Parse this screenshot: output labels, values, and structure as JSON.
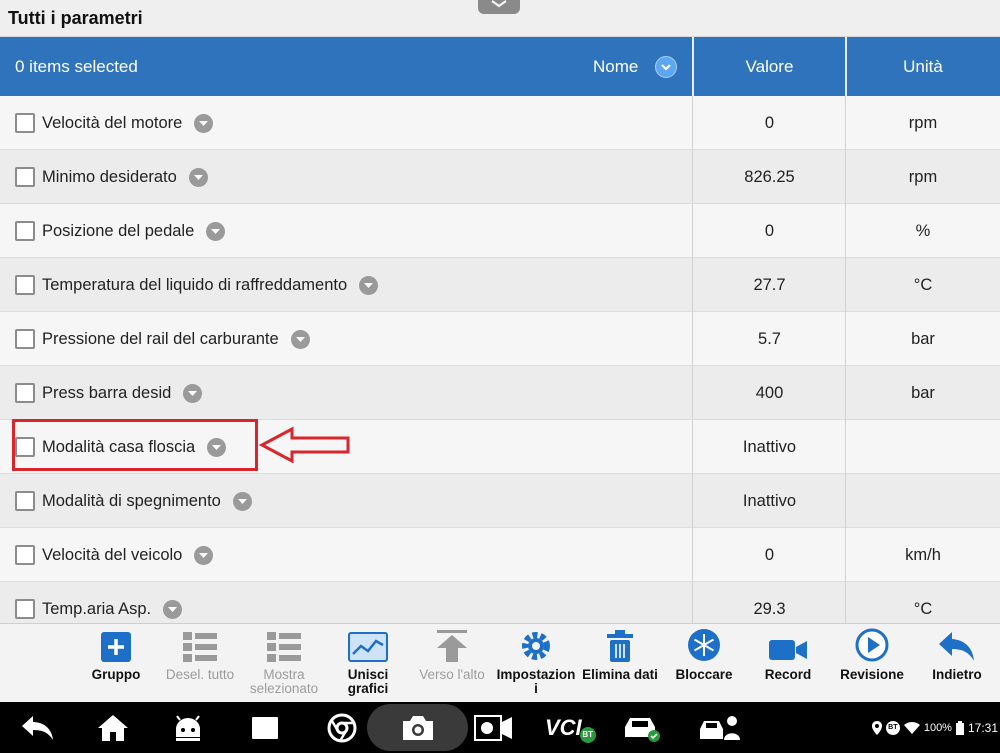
{
  "window": {
    "title": "Tutti i parametri"
  },
  "header": {
    "selection": "0 items selected",
    "name_col": "Nome",
    "value_col": "Valore",
    "unit_col": "Unità"
  },
  "rows": [
    {
      "name": "Velocità del motore",
      "value": "0",
      "unit": "rpm"
    },
    {
      "name": "Minimo desiderato",
      "value": "826.25",
      "unit": "rpm"
    },
    {
      "name": "Posizione del pedale",
      "value": "0",
      "unit": "%"
    },
    {
      "name": "Temperatura del liquido di raffreddamento",
      "value": "27.7",
      "unit": "°C"
    },
    {
      "name": "Pressione del rail del carburante",
      "value": "5.7",
      "unit": "bar"
    },
    {
      "name": "Press barra desid",
      "value": "400",
      "unit": "bar"
    },
    {
      "name": "Modalità casa floscia",
      "value": "Inattivo",
      "unit": ""
    },
    {
      "name": "Modalità di spegnimento",
      "value": "Inattivo",
      "unit": ""
    },
    {
      "name": "Velocità del veicolo",
      "value": "0",
      "unit": "km/h"
    },
    {
      "name": "Temp.aria Asp.",
      "value": "29.3",
      "unit": "°C"
    }
  ],
  "toolbar": {
    "group": "Gruppo",
    "deselect_all": "Desel. tutto",
    "show_selected_1": "Mostra",
    "show_selected_2": "selezionato",
    "merge_graphs_1": "Unisci",
    "merge_graphs_2": "grafici",
    "move_up": "Verso l'alto",
    "settings_1": "Impostazion",
    "settings_2": "i",
    "clear_data": "Elimina dati",
    "freeze": "Bloccare",
    "record": "Record",
    "review": "Revisione",
    "back": "Indietro"
  },
  "status_bar": {
    "vci": "VCI",
    "vci_badge": "BT",
    "bt": "BT",
    "battery": "100%",
    "time": "17:31"
  },
  "colors": {
    "header_blue": "#2f73bd",
    "highlight_red": "#d8262c",
    "icon_blue": "#1e6fc8"
  }
}
